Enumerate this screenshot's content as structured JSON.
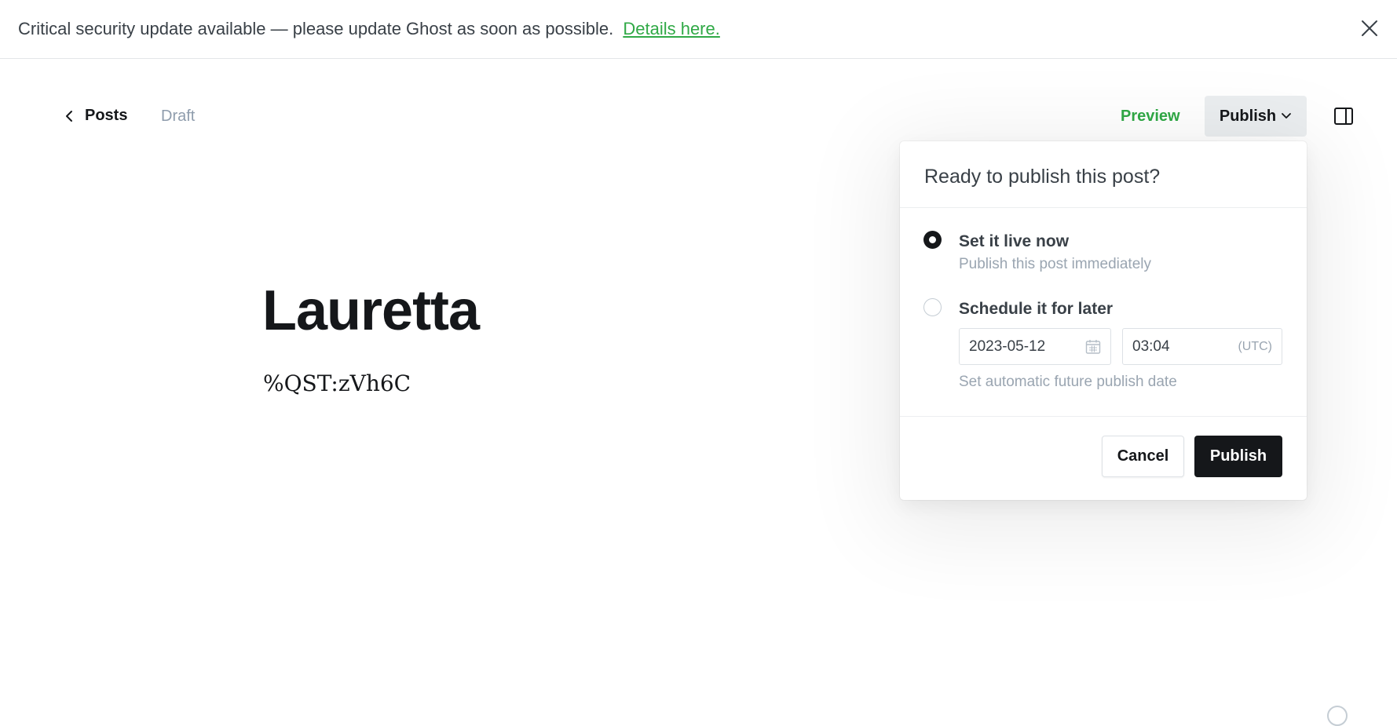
{
  "banner": {
    "message": "Critical security update available — please update Ghost as soon as possible.",
    "link_label": "Details here.",
    "close_icon": "close-icon"
  },
  "nav": {
    "back_label": "Posts",
    "status": "Draft",
    "preview_label": "Preview",
    "publish_label": "Publish",
    "sidebar_icon": "sidebar-toggle-icon"
  },
  "post": {
    "title": "Lauretta",
    "body": "%QST:zVh6C"
  },
  "publish_menu": {
    "title": "Ready to publish this post?",
    "options": [
      {
        "label": "Set it live now",
        "description": "Publish this post immediately",
        "selected": true
      },
      {
        "label": "Schedule it for later",
        "description": "Set automatic future publish date",
        "selected": false
      }
    ],
    "date_value": "2023-05-12",
    "time_value": "03:04",
    "timezone": "(UTC)",
    "cancel_label": "Cancel",
    "publish_label": "Publish"
  },
  "colors": {
    "accent_green": "#30a946",
    "dark": "#15171a",
    "muted": "#9aa5b1"
  }
}
